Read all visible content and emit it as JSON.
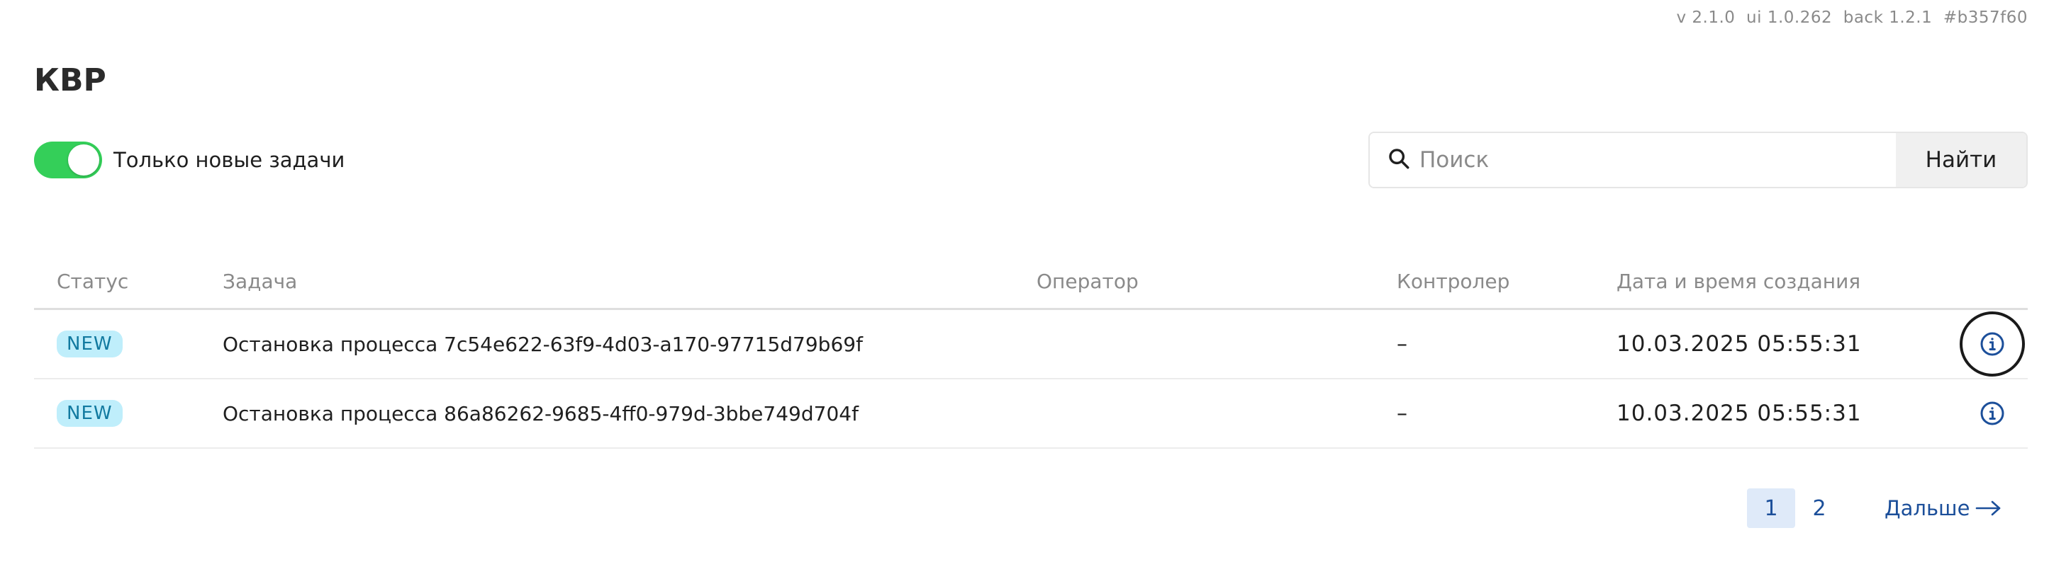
{
  "header": {
    "version_text": "v 2.1.0  ui 1.0.262  back 1.2.1  #b357f60",
    "title": "КВР"
  },
  "filters": {
    "only_new_label": "Только новые задачи",
    "only_new_enabled": true
  },
  "search": {
    "placeholder": "Поиск",
    "value": "",
    "button_label": "Найти"
  },
  "table": {
    "columns": {
      "status": "Статус",
      "task": "Задача",
      "operator": "Оператор",
      "controller": "Контролер",
      "created": "Дата и время создания"
    },
    "rows": [
      {
        "status": "NEW",
        "task": "Остановка процесса 7c54e622-63f9-4d03-a170-97715d79b69f",
        "operator": "",
        "controller": "–",
        "created": "10.03.2025 05:55:31"
      },
      {
        "status": "NEW",
        "task": "Остановка процесса 86a86262-9685-4ff0-979d-3bbe749d704f",
        "operator": "",
        "controller": "–",
        "created": "10.03.2025 05:55:31"
      }
    ]
  },
  "pagination": {
    "pages": [
      "1",
      "2"
    ],
    "current_page": "1",
    "next_label": "Дальше"
  },
  "icons": {
    "search": "search-icon",
    "info": "info-icon",
    "next": "arrow-right-icon"
  },
  "colors": {
    "toggle_on": "#34cf59",
    "badge_bg": "#bfeefb",
    "badge_text": "#127aa0",
    "link": "#1c4f9a"
  }
}
